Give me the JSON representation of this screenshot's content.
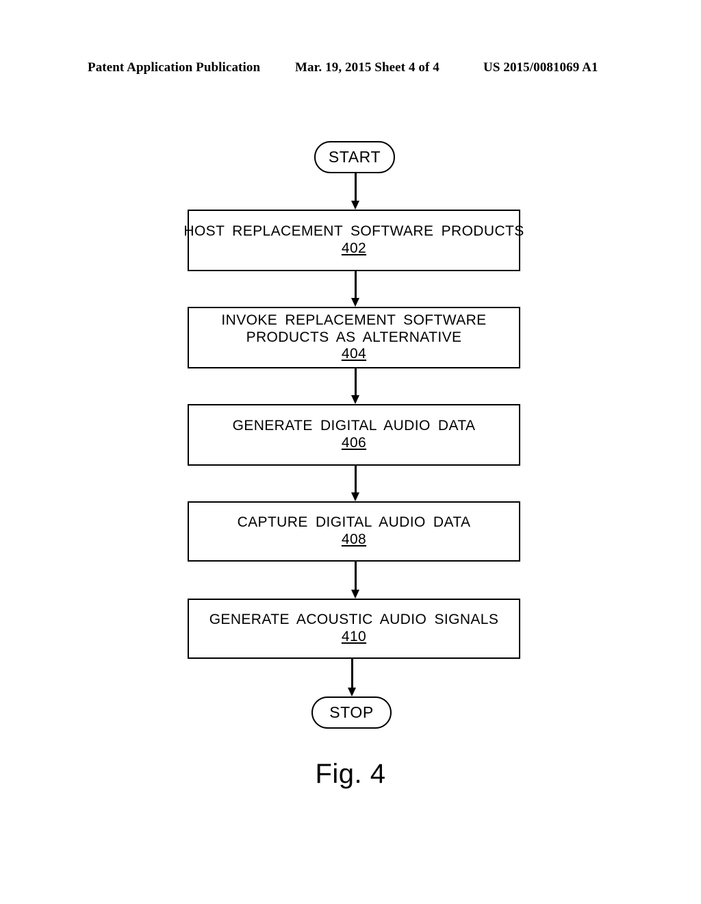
{
  "header": {
    "left": "Patent Application Publication",
    "middle": "Mar. 19, 2015  Sheet 4 of 4",
    "right": "US 2015/0081069 A1"
  },
  "figure": {
    "caption": "Fig. 4"
  },
  "flowchart": {
    "start": {
      "label": "START"
    },
    "stop": {
      "label": "STOP"
    },
    "steps": [
      {
        "ref": "402",
        "lines": [
          "HOST  REPLACEMENT  SOFTWARE  PRODUCTS"
        ]
      },
      {
        "ref": "404",
        "lines": [
          "INVOKE  REPLACEMENT  SOFTWARE",
          "PRODUCTS AS  ALTERNATIVE"
        ]
      },
      {
        "ref": "406",
        "lines": [
          "GENERATE  DIGITAL  AUDIO  DATA"
        ]
      },
      {
        "ref": "408",
        "lines": [
          "CAPTURE  DIGITAL  AUDIO  DATA"
        ]
      },
      {
        "ref": "410",
        "lines": [
          "GENERATE  ACOUSTIC  AUDIO  SIGNALS"
        ]
      }
    ]
  }
}
